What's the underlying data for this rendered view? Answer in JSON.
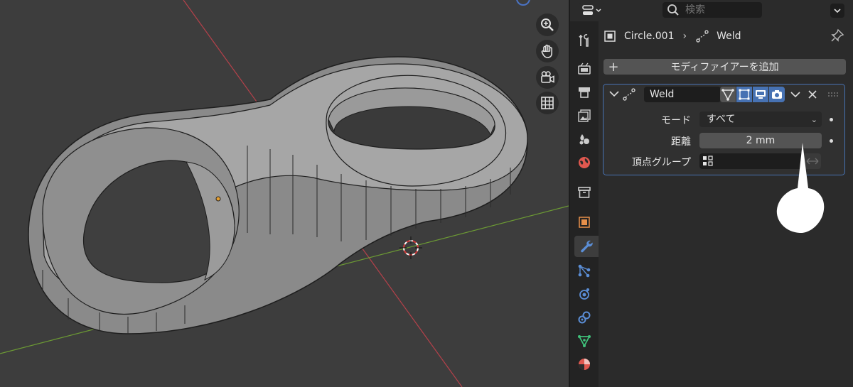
{
  "viewport": {
    "nav_icons": [
      "zoom-icon",
      "hand-pan-icon",
      "camera-icon",
      "grid-icon"
    ]
  },
  "header": {
    "search": {
      "placeholder": "検索"
    }
  },
  "tabs": [
    {
      "name": "tool-icon",
      "color": "#cccccc"
    },
    {
      "name": "render-icon",
      "color": "#cccccc"
    },
    {
      "name": "output-icon",
      "color": "#cccccc"
    },
    {
      "name": "view-layer-icon",
      "color": "#cccccc"
    },
    {
      "name": "scene-icon",
      "color": "#cccccc"
    },
    {
      "name": "world-icon",
      "color": "#e0584f"
    },
    {
      "name": "collection-icon",
      "color": "#cccccc"
    },
    {
      "name": "object-icon",
      "color": "#e8904a"
    },
    {
      "name": "modifier-wrench-icon",
      "color": "#5b8ed6",
      "active": true
    },
    {
      "name": "particles-icon",
      "color": "#5b8ed6"
    },
    {
      "name": "physics-icon",
      "color": "#5b8ed6"
    },
    {
      "name": "constraints-icon",
      "color": "#5b8ed6"
    },
    {
      "name": "data-icon",
      "color": "#3fc07a"
    },
    {
      "name": "material-icon",
      "color": "#e0584f"
    }
  ],
  "breadcrumb": {
    "object_name": "Circle.001",
    "modifier_name": "Weld"
  },
  "add_modifier": {
    "label": "モディファイアーを追加"
  },
  "modifier": {
    "name": "Weld",
    "mode": {
      "label": "モード",
      "value": "すべて"
    },
    "distance": {
      "label": "距離",
      "value": "2 mm"
    },
    "vertex_group": {
      "label": "頂点グループ",
      "value": ""
    }
  },
  "colors": {
    "accent": "#4772b3",
    "x_axis": "#b5414a",
    "y_axis": "#6c9a34"
  }
}
